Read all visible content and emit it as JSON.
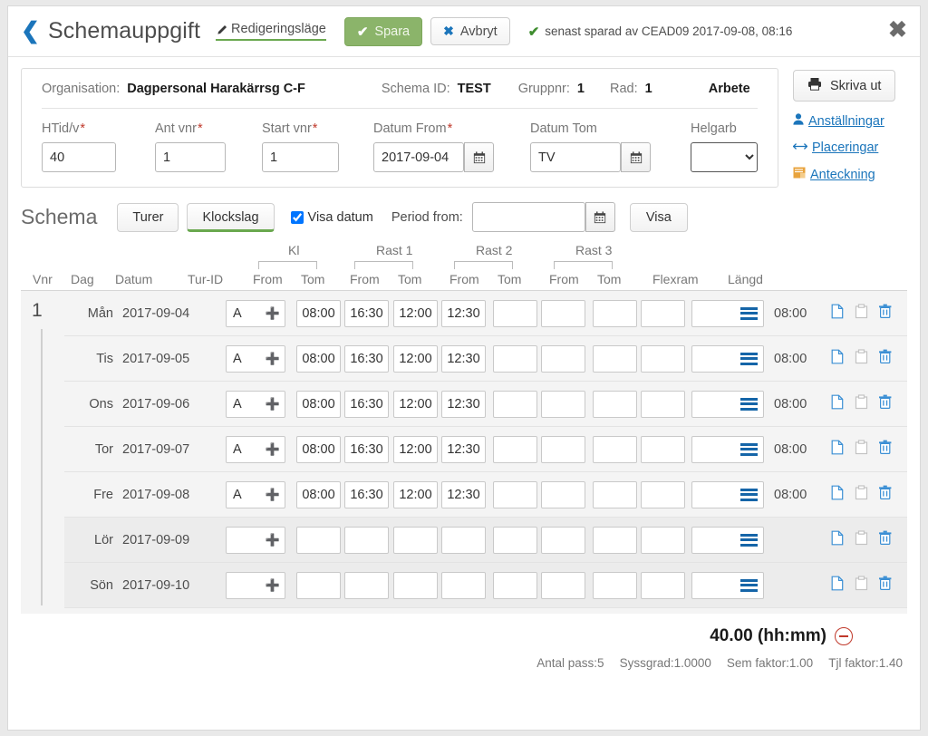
{
  "titlebar": {
    "back_icon": "chevron-left-icon",
    "title": "Schemauppgift",
    "edit_mode_label": "Redigeringsläge",
    "save_label": "Spara",
    "cancel_label": "Avbryt",
    "saved_note": "senast sparad av CEAD09 2017-09-08, 08:16",
    "close_icon": "close-icon"
  },
  "info": {
    "organisation_label": "Organisation:",
    "organisation_value": "Dagpersonal Harakärrsg C-F",
    "schema_id_label": "Schema ID:",
    "schema_id_value": "TEST",
    "gruppnr_label": "Gruppnr:",
    "gruppnr_value": "1",
    "rad_label": "Rad:",
    "rad_value": "1",
    "arbete_label": "Arbete",
    "fields": {
      "htid_label": "HTid/v",
      "htid_value": "40",
      "antvnr_label": "Ant vnr",
      "antvnr_value": "1",
      "startvnr_label": "Start vnr",
      "startvnr_value": "1",
      "datum_from_label": "Datum From",
      "datum_from_value": "2017-09-04",
      "datum_tom_label": "Datum Tom",
      "datum_tom_value": "TV",
      "helgarb_label": "Helgarb",
      "helgarb_value": "",
      "helgarb_options": [
        ""
      ]
    }
  },
  "side_actions": {
    "print_label": "Skriva ut",
    "print_icon": "printer-icon",
    "links": [
      {
        "label": "Anställningar",
        "icon": "user-icon"
      },
      {
        "label": "Placeringar",
        "icon": "arrows-horizontal-icon"
      },
      {
        "label": "Anteckning",
        "icon": "note-icon"
      }
    ]
  },
  "schema_toolbar": {
    "title": "Schema",
    "turer_label": "Turer",
    "klockslag_label": "Klockslag",
    "visa_datum_label": "Visa datum",
    "visa_datum_checked": true,
    "period_from_label": "Period from:",
    "period_from_value": "",
    "visa_label": "Visa"
  },
  "table": {
    "groups": [
      {
        "label": "Kl"
      },
      {
        "label": "Rast 1"
      },
      {
        "label": "Rast 2"
      },
      {
        "label": "Rast 3"
      }
    ],
    "columns": {
      "vnr": "Vnr",
      "dag": "Dag",
      "datum": "Datum",
      "turid": "Tur-ID",
      "kl_from": "From",
      "kl_tom": "Tom",
      "r1_from": "From",
      "r1_tom": "Tom",
      "r2_from": "From",
      "r2_tom": "Tom",
      "r3_from": "From",
      "r3_tom": "Tom",
      "flexram": "Flexram",
      "langd": "Längd"
    },
    "vnr_value": "1",
    "rows": [
      {
        "dag": "Mån",
        "datum": "2017-09-04",
        "turid": "A",
        "kl_from": "08:00",
        "kl_tom": "16:30",
        "r1_from": "12:00",
        "r1_tom": "12:30",
        "r2_from": "",
        "r2_tom": "",
        "r3_from": "",
        "r3_tom": "",
        "flexram": "",
        "langd": "08:00",
        "weekend": false
      },
      {
        "dag": "Tis",
        "datum": "2017-09-05",
        "turid": "A",
        "kl_from": "08:00",
        "kl_tom": "16:30",
        "r1_from": "12:00",
        "r1_tom": "12:30",
        "r2_from": "",
        "r2_tom": "",
        "r3_from": "",
        "r3_tom": "",
        "flexram": "",
        "langd": "08:00",
        "weekend": false
      },
      {
        "dag": "Ons",
        "datum": "2017-09-06",
        "turid": "A",
        "kl_from": "08:00",
        "kl_tom": "16:30",
        "r1_from": "12:00",
        "r1_tom": "12:30",
        "r2_from": "",
        "r2_tom": "",
        "r3_from": "",
        "r3_tom": "",
        "flexram": "",
        "langd": "08:00",
        "weekend": false
      },
      {
        "dag": "Tor",
        "datum": "2017-09-07",
        "turid": "A",
        "kl_from": "08:00",
        "kl_tom": "16:30",
        "r1_from": "12:00",
        "r1_tom": "12:30",
        "r2_from": "",
        "r2_tom": "",
        "r3_from": "",
        "r3_tom": "",
        "flexram": "",
        "langd": "08:00",
        "weekend": false
      },
      {
        "dag": "Fre",
        "datum": "2017-09-08",
        "turid": "A",
        "kl_from": "08:00",
        "kl_tom": "16:30",
        "r1_from": "12:00",
        "r1_tom": "12:30",
        "r2_from": "",
        "r2_tom": "",
        "r3_from": "",
        "r3_tom": "",
        "flexram": "",
        "langd": "08:00",
        "weekend": false
      },
      {
        "dag": "Lör",
        "datum": "2017-09-09",
        "turid": "",
        "kl_from": "",
        "kl_tom": "",
        "r1_from": "",
        "r1_tom": "",
        "r2_from": "",
        "r2_tom": "",
        "r3_from": "",
        "r3_tom": "",
        "flexram": "",
        "langd": "",
        "weekend": true
      },
      {
        "dag": "Sön",
        "datum": "2017-09-10",
        "turid": "",
        "kl_from": "",
        "kl_tom": "",
        "r1_from": "",
        "r1_tom": "",
        "r2_from": "",
        "r2_tom": "",
        "r3_from": "",
        "r3_tom": "",
        "flexram": "",
        "langd": "",
        "weekend": true
      }
    ],
    "row_actions": {
      "copy_icon": "copy-icon",
      "paste_icon": "paste-icon",
      "delete_icon": "trash-icon"
    }
  },
  "footer": {
    "total": "40.00 (hh:mm)",
    "collapse_icon": "minus-circle-icon",
    "meta": [
      "Antal pass:5",
      "Syssgrad:1.0000",
      "Sem faktor:1.00",
      "Tjl faktor:1.40"
    ]
  },
  "colors": {
    "accent_blue": "#1b75bb",
    "accent_green": "#6aa84f",
    "save_green": "#8bb46a",
    "required_red": "#c0392b",
    "plus_green": "#4ca417",
    "note_orange": "#e8a33d"
  }
}
